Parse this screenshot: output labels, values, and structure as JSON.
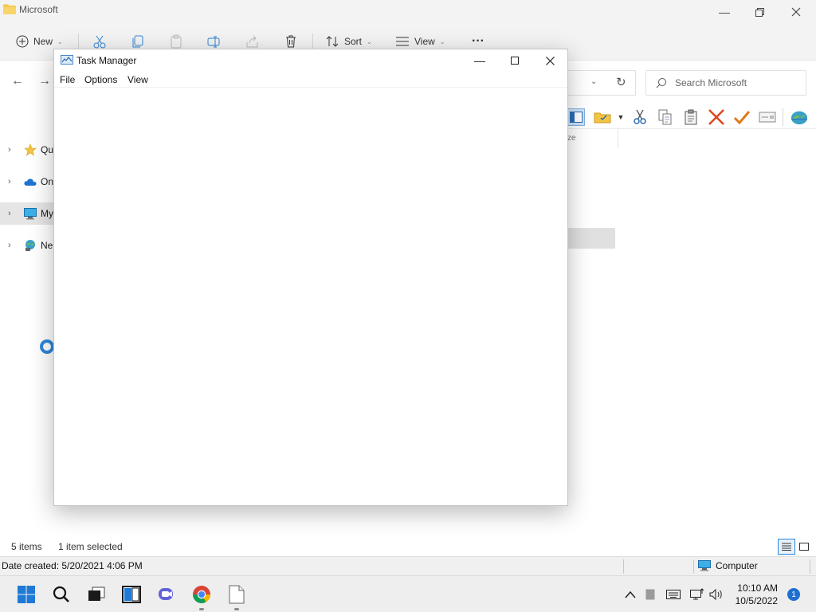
{
  "explorer": {
    "title": "Microsoft",
    "toolbar": {
      "new_label": "New",
      "sort_label": "Sort",
      "view_label": "View",
      "more_label": "···"
    },
    "search_placeholder": "Search Microsoft",
    "nav": [
      {
        "label": "Qu",
        "icon": "star-icon"
      },
      {
        "label": "On",
        "icon": "cloud-icon"
      },
      {
        "label": "My",
        "icon": "computer-icon"
      },
      {
        "label": "Ne",
        "icon": "network-icon"
      }
    ],
    "column_fragment": "ze",
    "status": {
      "items_count": "5 items",
      "selected": "1 item selected"
    },
    "info": {
      "date_created": "Date created: 5/20/2021 4:06 PM",
      "location": "Computer"
    }
  },
  "taskmgr": {
    "title": "Task Manager",
    "menu": [
      "File",
      "Options",
      "View"
    ]
  },
  "taskbar": {
    "time": "10:10 AM",
    "date": "10/5/2022",
    "notification_count": "1"
  },
  "colors": {
    "accent": "#2f86d9",
    "badge": "#1f6fd1",
    "folder": "#f4c542"
  }
}
